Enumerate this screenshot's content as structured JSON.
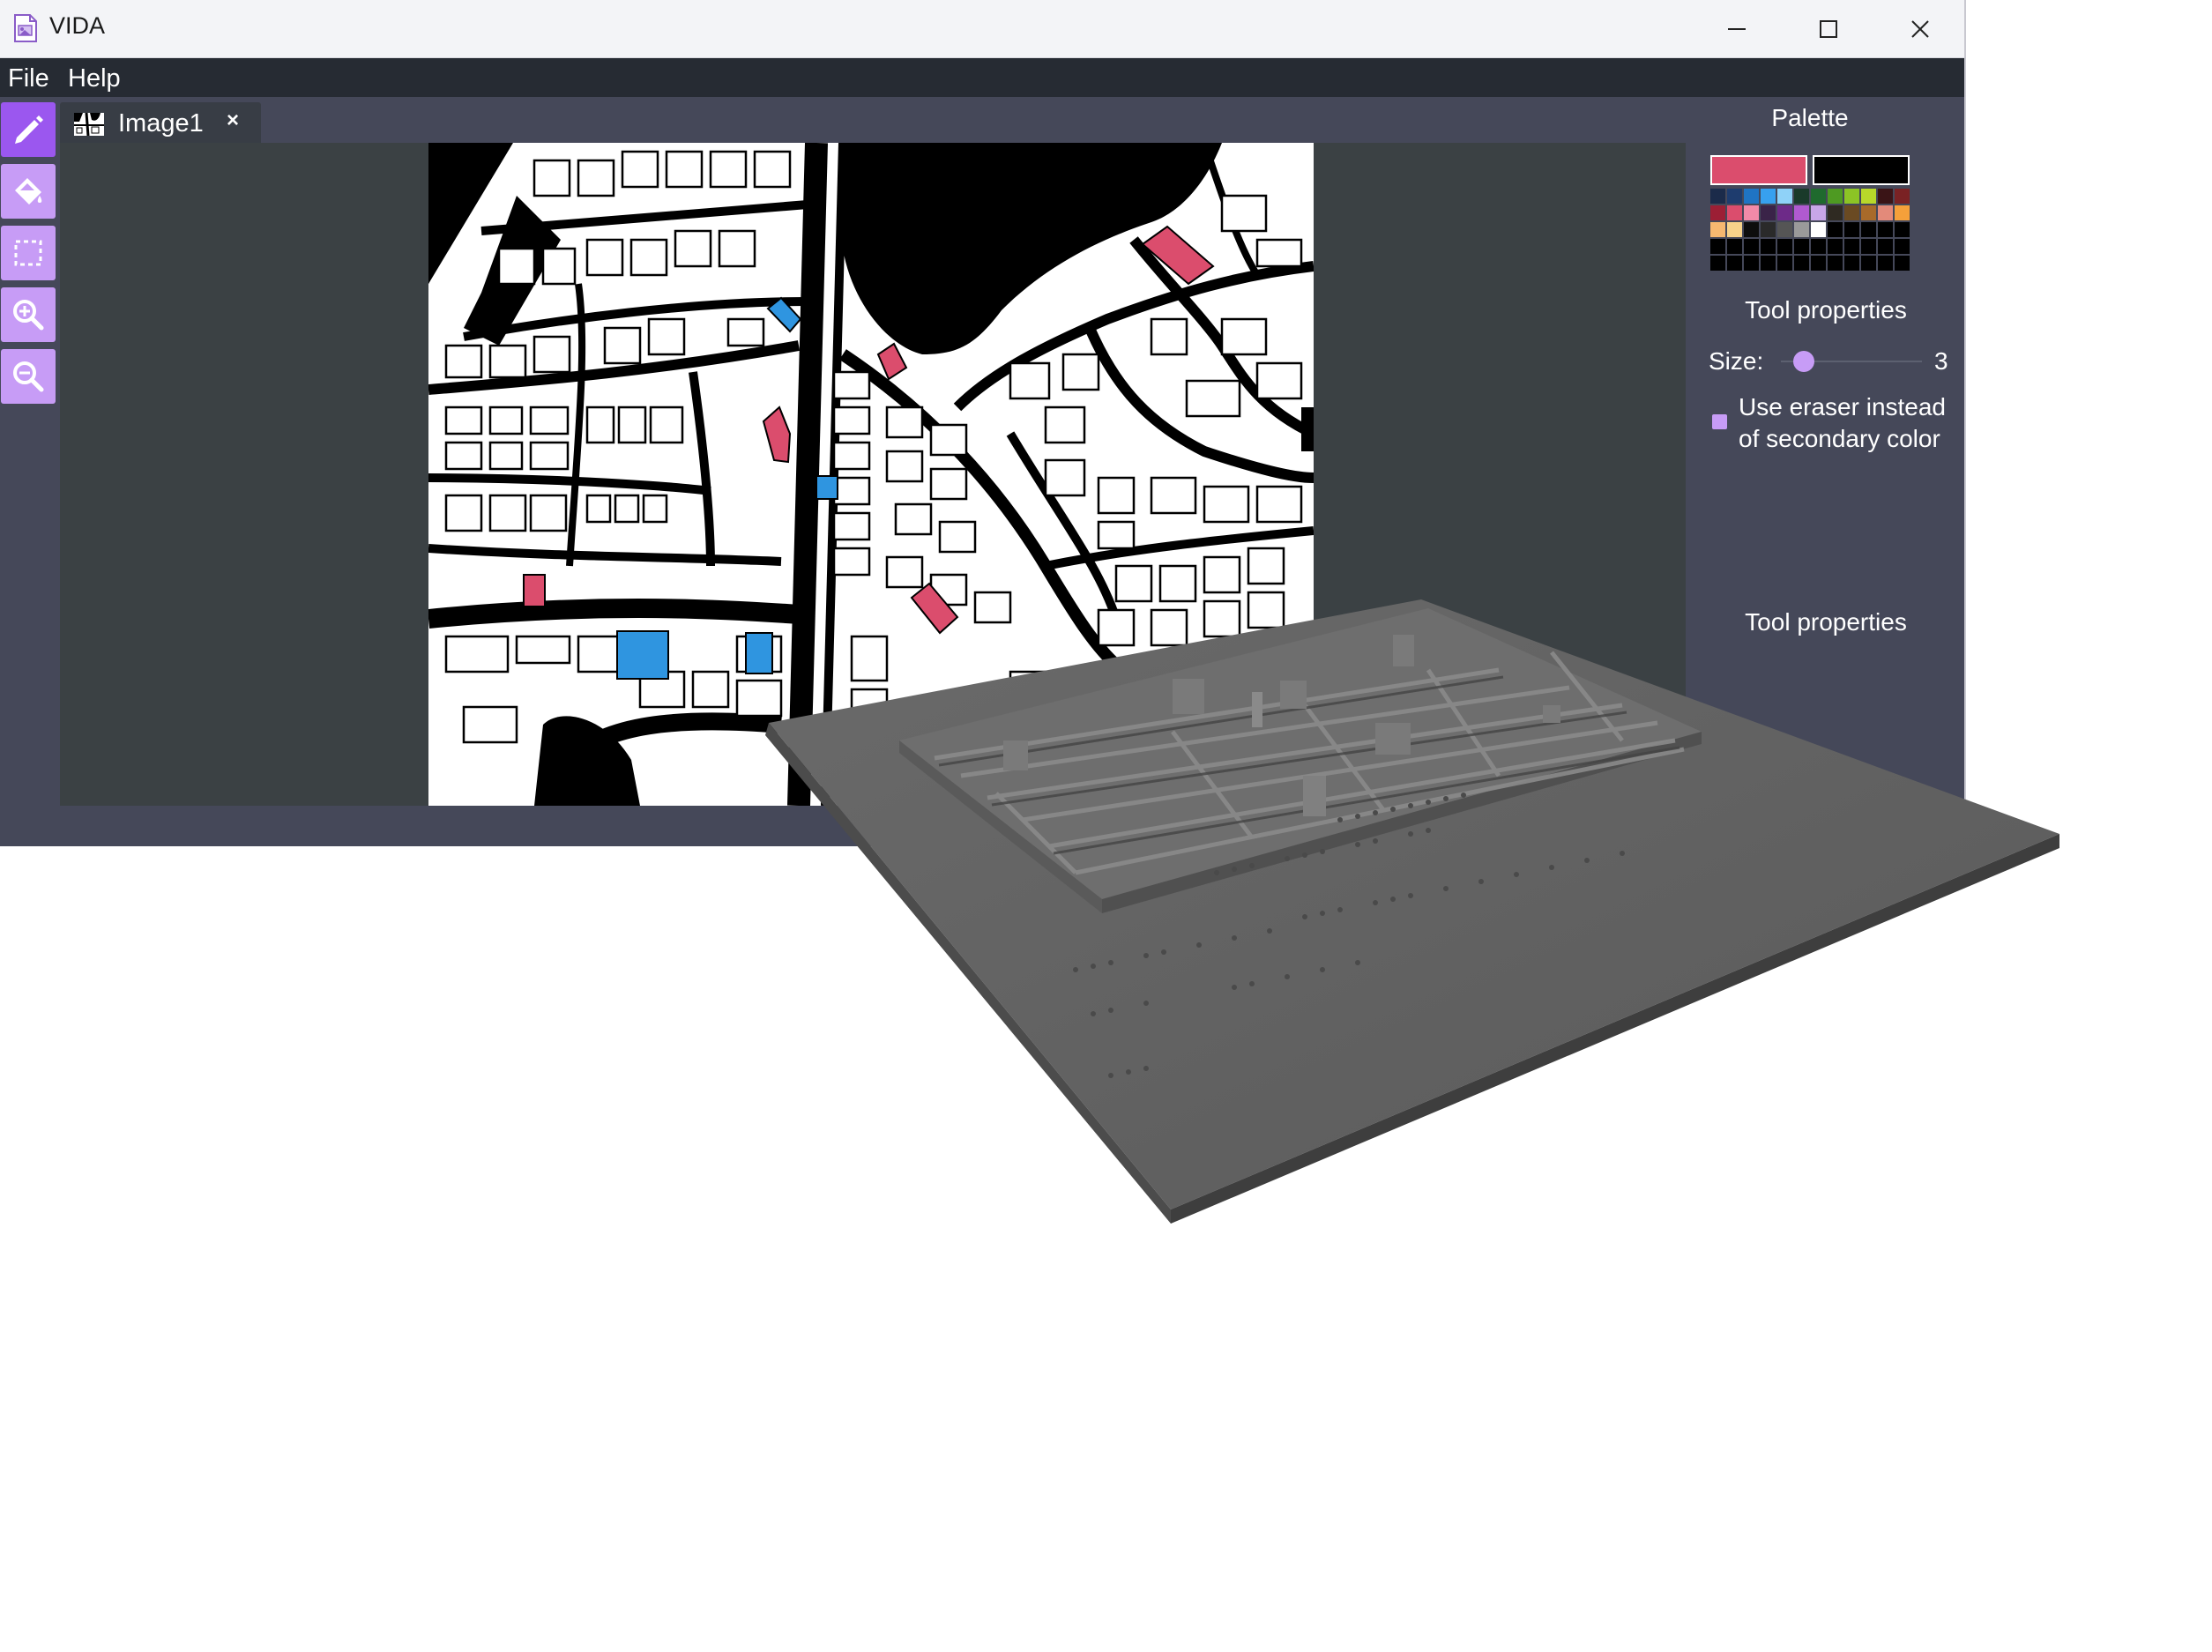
{
  "window": {
    "title": "VIDA",
    "icons": {
      "app": "image-file-icon",
      "minimize": "minimize-icon",
      "maximize": "maximize-icon",
      "close": "close-icon"
    }
  },
  "menu": {
    "file": "File",
    "help": "Help"
  },
  "toolbar": {
    "tools": [
      {
        "name": "pencil-tool",
        "icon": "pencil-icon",
        "active": true
      },
      {
        "name": "fill-tool",
        "icon": "paint-bucket-icon",
        "active": false
      },
      {
        "name": "select-tool",
        "icon": "selection-icon",
        "active": false
      },
      {
        "name": "zoom-in-tool",
        "icon": "zoom-in-icon",
        "active": false
      },
      {
        "name": "zoom-out-tool",
        "icon": "zoom-out-icon",
        "active": false
      }
    ]
  },
  "tabs": [
    {
      "label": "Image1",
      "close": "×"
    }
  ],
  "panel": {
    "palette_heading": "Palette",
    "primary_color": "#db4d6d",
    "secondary_color": "#000000",
    "palette_colors": [
      "#1b2b4a",
      "#1e3c6e",
      "#1f74c4",
      "#37a0ef",
      "#8fd2f8",
      "#1a3a2a",
      "#1f6a2e",
      "#4e9a22",
      "#8cc425",
      "#b8d82a",
      "#3a1416",
      "#7a2224",
      "#9c1f35",
      "#db4d6d",
      "#f28aa8",
      "#3a2348",
      "#6d2a88",
      "#b05ad0",
      "#c8a6e8",
      "#2f2a22",
      "#6a4a22",
      "#a86a2a",
      "#e38a7a",
      "#f5a03a",
      "#f6b870",
      "#f7d28a",
      "#0d0d0d",
      "#2a2a2a",
      "#555555",
      "#9a9a9a",
      "#ffffff",
      "#000000",
      "#000000",
      "#000000",
      "#000000",
      "#000000",
      "#000000",
      "#000000",
      "#000000",
      "#000000",
      "#000000",
      "#000000",
      "#000000",
      "#000000",
      "#000000",
      "#000000",
      "#000000",
      "#000000",
      "#000000",
      "#000000",
      "#000000",
      "#000000",
      "#000000",
      "#000000",
      "#000000",
      "#000000",
      "#000000",
      "#000000",
      "#000000",
      "#000000"
    ],
    "tool_properties_heading": "Tool properties",
    "size_label": "Size:",
    "size_value": "3",
    "size_min": 1,
    "size_max": 20,
    "eraser_label": "Use eraser instead of secondary color",
    "eraser_checked": true,
    "tool_properties_heading_2": "Tool properties"
  },
  "colors": {
    "accent": "#c79cf6",
    "accent_active": "#9b57ef",
    "menubar": "#262b33",
    "workspace": "#454859",
    "canvas_bg": "#3b4144",
    "highlight_pink": "#db4d6d",
    "highlight_blue": "#2f95e0",
    "model_gray": "#5e5e5e"
  }
}
